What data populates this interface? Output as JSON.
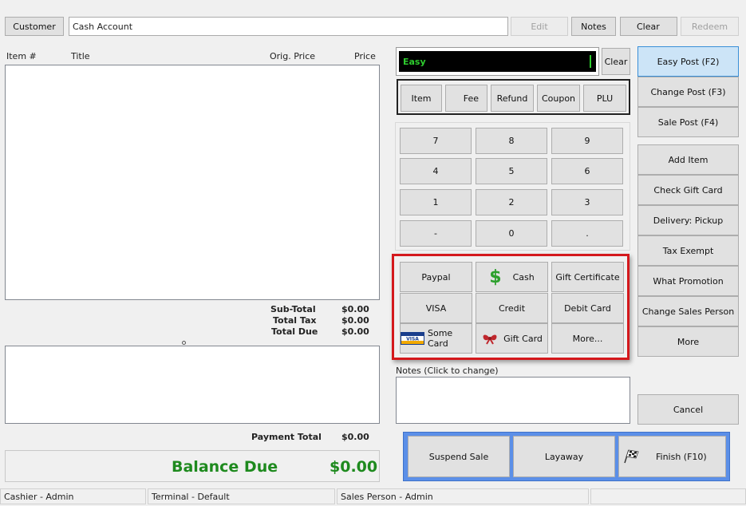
{
  "top": {
    "customer_label": "Customer",
    "account_value": "Cash Account",
    "edit_label": "Edit",
    "notes_label": "Notes",
    "clear_label": "Clear",
    "redeem_label": "Redeem"
  },
  "items_table": {
    "columns": [
      "Item #",
      "Title",
      "Orig. Price",
      "Price"
    ]
  },
  "totals": {
    "subtotal_label": "Sub-Total",
    "subtotal_value": "$0.00",
    "tax_label": "Total Tax",
    "tax_value": "$0.00",
    "due_label": "Total Due",
    "due_value": "$0.00",
    "payment_total_label": "Payment Total",
    "payment_total_value": "$0.00",
    "balance_label": "Balance Due",
    "balance_value": "$0.00"
  },
  "entry": {
    "display_text": "Easy",
    "clear_label": "Clear"
  },
  "mode_buttons": [
    "Item",
    "Fee",
    "Refund",
    "Coupon",
    "PLU"
  ],
  "keypad": [
    "7",
    "8",
    "9",
    "4",
    "5",
    "6",
    "1",
    "2",
    "3",
    "-",
    "0",
    "."
  ],
  "payments": {
    "paypal": "Paypal",
    "cash": "Cash",
    "gift_certificate": "Gift Certificate",
    "visa": "VISA",
    "credit": "Credit",
    "debit_card": "Debit Card",
    "some_card": "Some Card",
    "gift_card": "Gift Card",
    "more": "More..."
  },
  "notes": {
    "label": "Notes (Click to change)"
  },
  "right_panel": {
    "easy_post": "Easy Post (F2)",
    "change_post": "Change Post (F3)",
    "sale_post": "Sale Post (F4)",
    "add_item": "Add Item",
    "check_gift_card": "Check Gift Card",
    "delivery": "Delivery: Pickup",
    "tax_exempt": "Tax Exempt",
    "what_promotion": "What Promotion",
    "change_sales_person": "Change Sales Person",
    "more": "More",
    "cancel": "Cancel"
  },
  "bottom_actions": {
    "suspend": "Suspend Sale",
    "layaway": "Layaway",
    "finish": "Finish (F10)"
  },
  "status": {
    "cashier": "Cashier - Admin",
    "terminal": "Terminal - Default",
    "sales_person": "Sales Person - Admin"
  },
  "colors": {
    "balance_green": "#1e8a1e",
    "entry_bg": "#000000",
    "entry_text": "#2ecc2e",
    "highlight_red": "#d4181c",
    "action_blue": "#5b8fe8",
    "selected_blue": "#cce4f7"
  },
  "icons": {
    "cash": "dollar-sign-icon",
    "some_card": "visa-card-icon",
    "gift_card": "gift-bow-icon",
    "finish": "checkered-flag-icon"
  }
}
